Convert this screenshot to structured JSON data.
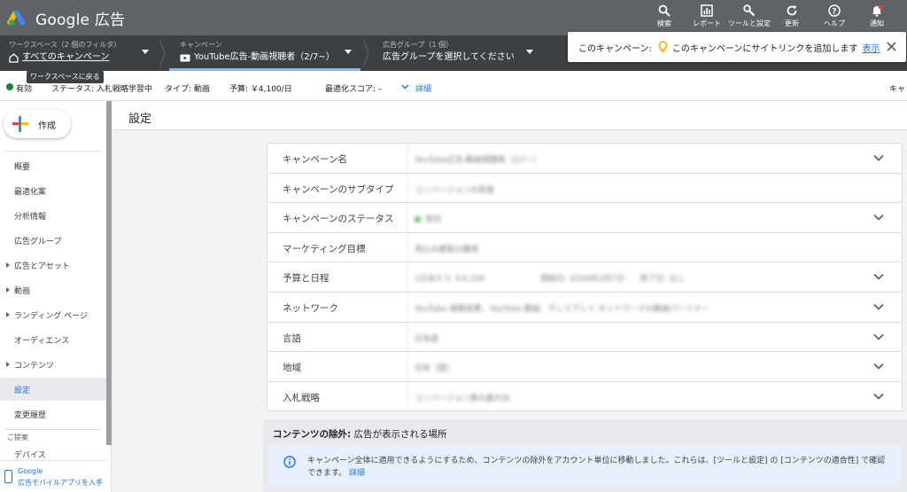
{
  "app": {
    "title": "Google 広告"
  },
  "top_actions": [
    {
      "name": "search",
      "label": "検索",
      "icon": "search-icon"
    },
    {
      "name": "reports",
      "label": "レポート",
      "icon": "bar-chart-icon"
    },
    {
      "name": "tools",
      "label": "ツールと設定",
      "icon": "wrench-icon"
    },
    {
      "name": "refresh",
      "label": "更新",
      "icon": "refresh-icon"
    },
    {
      "name": "help",
      "label": "ヘルプ",
      "icon": "help-icon"
    },
    {
      "name": "notifications",
      "label": "通知",
      "icon": "bell-icon"
    }
  ],
  "breadcrumb": {
    "workspace": {
      "small": "ワークスペース（2 個のフィルタ）",
      "main": "すべてのキャンペーン"
    },
    "campaign": {
      "small": "キャンペーン",
      "main": "YouTube広告-動画視聴者（2/7~）"
    },
    "adgroup": {
      "small": "広告グループ（1 個）",
      "main": "広告グループを選択してください"
    }
  },
  "notice": {
    "prefix": "このキャンペーン:",
    "message": "このキャンペーンにサイトリンクを追加します",
    "link": "表示"
  },
  "tooltip": "ワークスペースに戻る",
  "status": {
    "enabled": "有効",
    "status_text": "ステータス: 入札戦略学習中",
    "type": "タイプ: 動画",
    "budget": "予算: ￥4,100/日",
    "optimization": "最適化スコア: –",
    "details": "詳細",
    "right_cut": "キャ"
  },
  "sidebar": {
    "create_label": "作成",
    "items": [
      {
        "label": "概要",
        "expandable": false,
        "active": false
      },
      {
        "label": "最適化案",
        "expandable": false,
        "active": false
      },
      {
        "label": "分析情報",
        "expandable": false,
        "active": false
      },
      {
        "label": "広告グループ",
        "expandable": false,
        "active": false
      },
      {
        "label": "広告とアセット",
        "expandable": true,
        "active": false
      },
      {
        "label": "動画",
        "expandable": true,
        "active": false
      },
      {
        "label": "ランディング ページ",
        "expandable": true,
        "active": false
      },
      {
        "label": "オーディエンス",
        "expandable": false,
        "active": false
      },
      {
        "label": "コンテンツ",
        "expandable": true,
        "active": false
      },
      {
        "label": "設定",
        "expandable": false,
        "active": true
      },
      {
        "label": "変更履歴",
        "expandable": false,
        "active": false
      }
    ],
    "section_label": "ご提案",
    "device_label": "デバイス",
    "promo_line1": "Google",
    "promo_line2": "広告モバイルアプリを入手"
  },
  "page": {
    "title": "設定"
  },
  "settings": [
    {
      "label": "キャンペーン名",
      "value": "YouTube広告-動画視聴者（2/7~）",
      "expandable": true,
      "dot": false
    },
    {
      "label": "キャンペーンのサブタイプ",
      "value": "コンバージョンの促進",
      "expandable": false,
      "dot": false
    },
    {
      "label": "キャンペーンのステータス",
      "value": "有効",
      "expandable": true,
      "dot": true
    },
    {
      "label": "マーケティング目標",
      "value": "見込み顧客の獲得",
      "expandable": false,
      "dot": false
    },
    {
      "label": "予算と日程",
      "value": "1日あたり ￥4,100　　　　　　　開始日: 2024年2月7日　　終了日: なし",
      "expandable": true,
      "dot": false
    },
    {
      "label": "ネットワーク",
      "value": "YouTube 検索結果、YouTube 動画、ディスプレイ ネットワークの動画パートナー",
      "expandable": true,
      "dot": false
    },
    {
      "label": "言語",
      "value": "日本語",
      "expandable": true,
      "dot": false
    },
    {
      "label": "地域",
      "value": "日本（国）",
      "expandable": true,
      "dot": false
    },
    {
      "label": "入札戦略",
      "value": "コンバージョン数の最大化",
      "expandable": true,
      "dot": false
    }
  ],
  "exclusion": {
    "title_bold": "コンテンツの除外:",
    "title_rest": " 広告が表示される場所",
    "info": "キャンペーン全体に適用できるようにするため、コンテンツの除外をアカウント単位に移動しました。これらは、[ツールと設定] の [コンテンツの適合性] で確認できます。",
    "link": "詳細"
  },
  "colors": {
    "accent": "#1a73e8",
    "topbar": "#5f6368",
    "navbar": "#3c4043",
    "status_green": "#188038"
  }
}
